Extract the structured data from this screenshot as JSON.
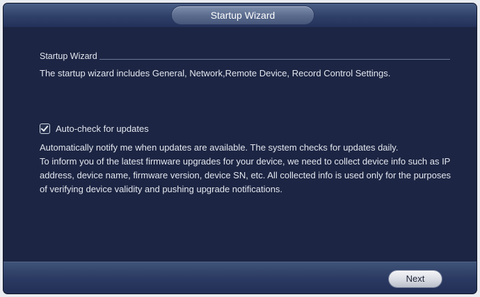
{
  "window": {
    "title": "Startup Wizard"
  },
  "section": {
    "title": "Startup Wizard",
    "intro": "The startup wizard includes General, Network,Remote Device, Record Control Settings."
  },
  "auto_check": {
    "label": "Auto-check for updates",
    "checked": true
  },
  "description": {
    "line1": "Automatically notify me when updates are available. The system checks for updates daily.",
    "line2": "To inform you of the latest firmware upgrades for your device, we need to collect device info such as IP address, device name, firmware version, device SN, etc. All collected info is used only for the purposes of verifying device validity and pushing upgrade notifications."
  },
  "footer": {
    "next_label": "Next"
  }
}
